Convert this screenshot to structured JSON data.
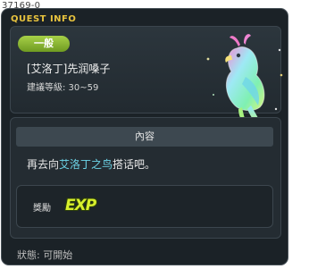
{
  "quest_id": "37169-0",
  "window": {
    "title": "QUEST INFO"
  },
  "header": {
    "badge": "一般",
    "quest_name": "[艾洛丁]先润嗓子",
    "level_range": "建議等級: 30~59"
  },
  "content": {
    "section_title": "內容",
    "text_before": "再去向",
    "npc_name": "艾洛丁之鸟",
    "text_after": "搭话吧。"
  },
  "reward": {
    "label": "獎勵",
    "exp_icon_text": "EXP"
  },
  "status": "狀態:  可開始",
  "colors": {
    "title": "#e8c33e",
    "badge": "#8cb832",
    "npc_link": "#6dd5e8"
  }
}
